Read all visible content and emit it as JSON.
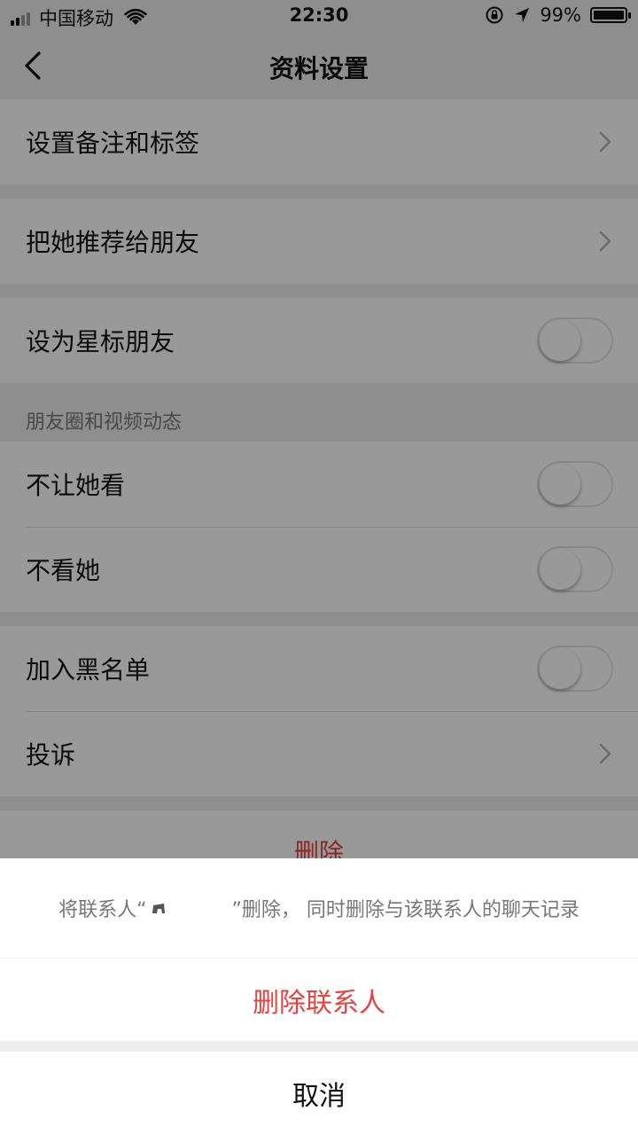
{
  "status_bar": {
    "carrier": "中国移动",
    "time": "22:30",
    "battery_percent": "99%",
    "battery_level": 0.99
  },
  "nav": {
    "title": "资料设置",
    "back_icon": "chevron-left-icon"
  },
  "items": {
    "remark_tags": {
      "label": "设置备注和标签"
    },
    "recommend": {
      "label": "把她推荐给朋友"
    },
    "star_friend": {
      "label": "设为星标朋友",
      "on": false
    },
    "moments_header": "朋友圈和视频动态",
    "hide_my_moments": {
      "label": "不让她看",
      "on": false
    },
    "hide_her_moments": {
      "label": "不看她",
      "on": false
    },
    "blacklist": {
      "label": "加入黑名单",
      "on": false
    },
    "report": {
      "label": "投诉"
    },
    "delete": {
      "label": "删除"
    }
  },
  "action_sheet": {
    "message_prefix": "将联系人“",
    "message_suffix": "”删除， 同时删除与该联系人的聊天记录",
    "delete_contact": "删除联系人",
    "cancel": "取消"
  },
  "colors": {
    "destructive": "#e64340",
    "background": "#ededed",
    "overlay": "rgba(0,0,0,0.40)"
  }
}
